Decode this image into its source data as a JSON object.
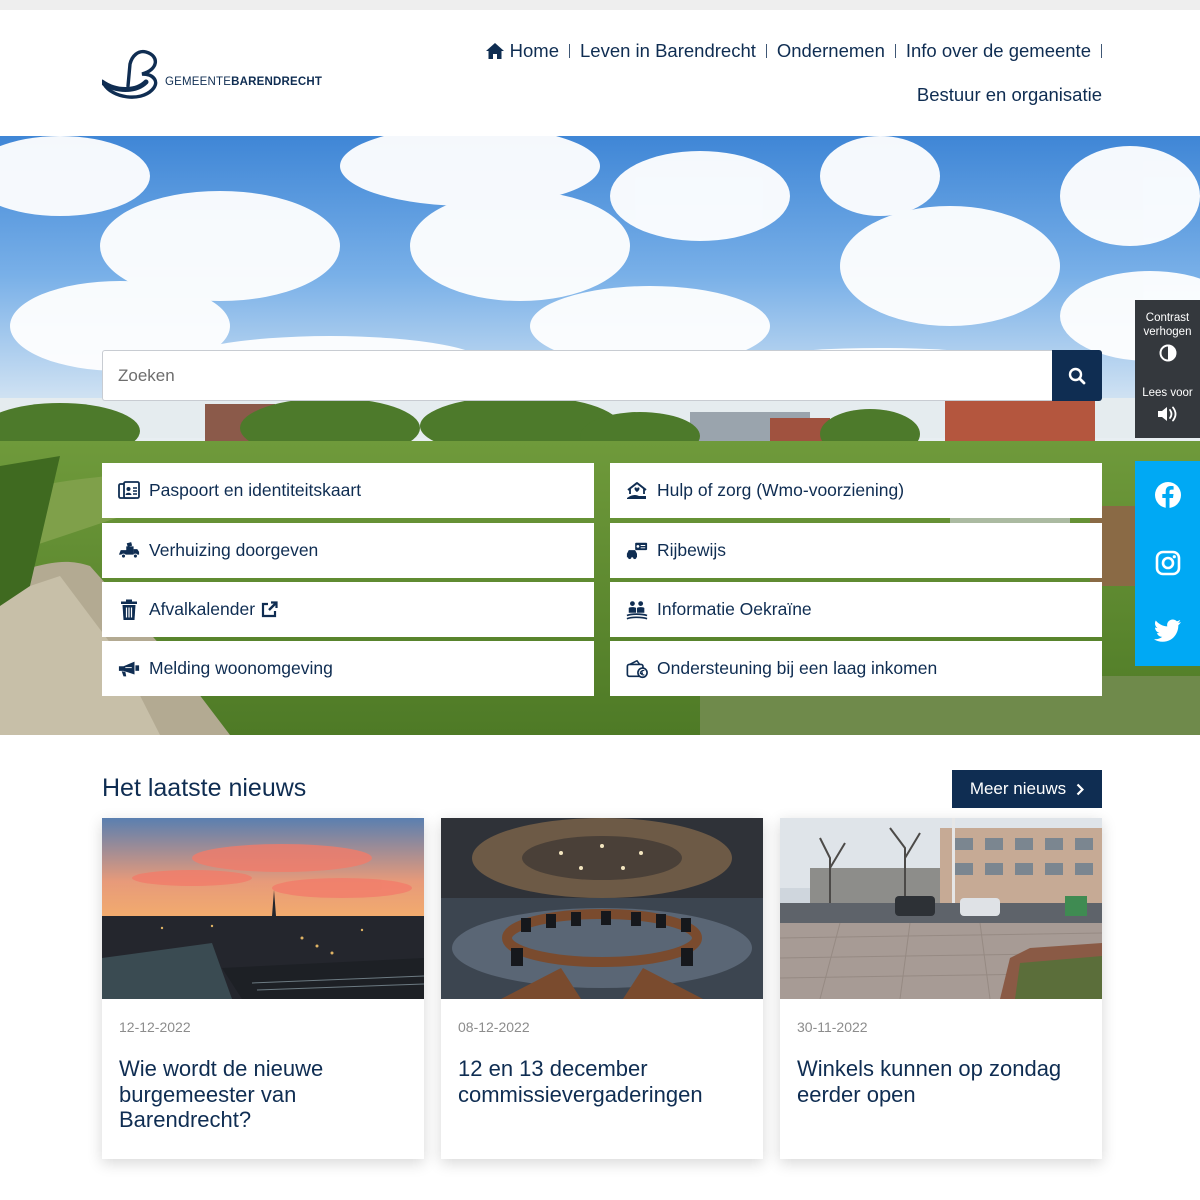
{
  "logo": {
    "name_part1": "GEMEENTE",
    "name_part2": "BARENDRECHT",
    "icon": "barendrecht-b-logo"
  },
  "nav": {
    "items": [
      {
        "label": "Home",
        "icon": "home-icon"
      },
      {
        "label": "Leven in Barendrecht"
      },
      {
        "label": "Ondernemen"
      },
      {
        "label": "Info over de gemeente"
      },
      {
        "label": "Bestuur en organisatie"
      }
    ]
  },
  "search": {
    "placeholder": "Zoeken",
    "value": "",
    "icon": "search-icon"
  },
  "tiles": [
    {
      "label": "Paspoort en identiteitskaart",
      "icon": "id-card-icon"
    },
    {
      "label": "Hulp of zorg (Wmo-voorziening)",
      "icon": "care-house-icon"
    },
    {
      "label": "Verhuizing doorgeven",
      "icon": "moving-truck-icon"
    },
    {
      "label": "Rijbewijs",
      "icon": "driver-license-icon"
    },
    {
      "label": "Afvalkalender",
      "icon": "trash-icon",
      "external": true
    },
    {
      "label": "Informatie Oekraïne",
      "icon": "people-info-icon"
    },
    {
      "label": "Melding woonomgeving",
      "icon": "megaphone-icon"
    },
    {
      "label": "Ondersteuning bij een laag inkomen",
      "icon": "wallet-icon"
    }
  ],
  "accessibility": {
    "contrast_label": "Contrast verhogen",
    "read_label": "Lees voor"
  },
  "social": [
    "facebook-icon",
    "instagram-icon",
    "twitter-icon"
  ],
  "news": {
    "title": "Het laatste nieuws",
    "more_label": "Meer nieuws",
    "items": [
      {
        "date": "12-12-2022",
        "title": "Wie wordt de nieuwe burgemeester van Barendrecht?"
      },
      {
        "date": "08-12-2022",
        "title": "12 en 13 december commissievergaderingen"
      },
      {
        "date": "30-11-2022",
        "title": "Winkels kunnen op zondag eerder open"
      }
    ]
  },
  "colors": {
    "brand": "#0f2d52",
    "social": "#00a9f4",
    "a11y_panel": "#34383d"
  }
}
